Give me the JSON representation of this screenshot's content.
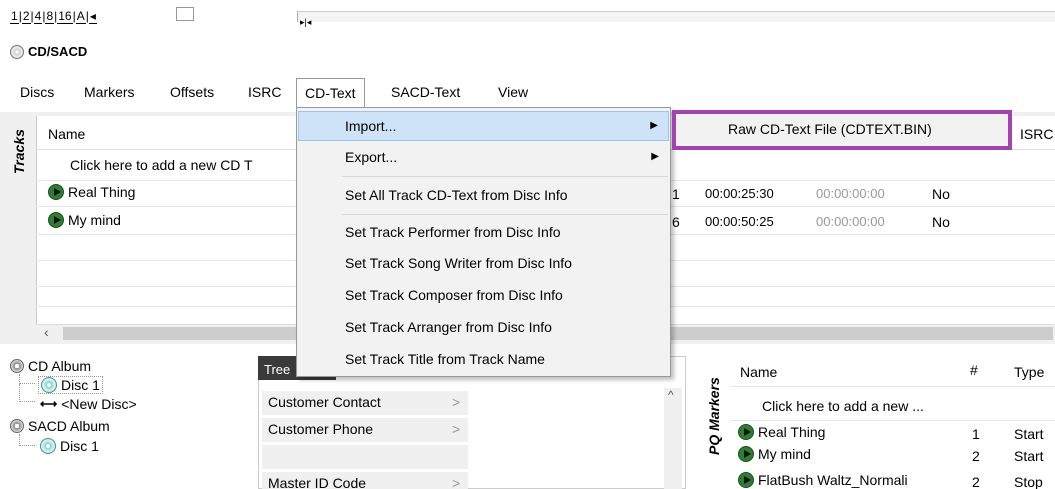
{
  "toolbar": {
    "zoom_buttons": [
      "1",
      "2",
      "4",
      "8",
      "16",
      "A",
      "◂"
    ],
    "hscroll_arrows": "▸|◂"
  },
  "section_title": "CD/SACD",
  "menu": [
    "Discs",
    "Markers",
    "Offsets",
    "ISRC",
    "CD-Text",
    "SACD-Text",
    "View"
  ],
  "tracks": {
    "side_label": "Tracks",
    "col_name": "Name",
    "col_isrc": "ISRC",
    "add_hint": "Click here to add a new CD T",
    "rows": [
      {
        "name": "Real Thing",
        "num_tail": "1",
        "duration": "00:00:25:30",
        "offset": "00:00:00:00",
        "flag": "No"
      },
      {
        "name": "My mind",
        "num_tail": "6",
        "duration": "00:00:50:25",
        "offset": "00:00:00:00",
        "flag": "No"
      }
    ]
  },
  "context_menu": {
    "items": [
      "Import...",
      "Export...",
      "Set All Track CD-Text from Disc Info",
      "Set Track Performer from Disc Info",
      "Set Track Song Writer from Disc Info",
      "Set Track Composer from Disc Info",
      "Set Track Arranger from Disc Info",
      "Set Track Title from Track Name"
    ],
    "submenu_item": "Raw CD-Text File (CDTEXT.BIN)",
    "highlight_color": "#cfe3f8",
    "submenu_border": "#a044b0"
  },
  "tree": {
    "cd_album": "CD Album",
    "disc1": "Disc 1",
    "new_disc": "<New Disc>",
    "sacd_album": "SACD Album",
    "sacd_disc1": "Disc 1"
  },
  "props": {
    "tab": "Tree",
    "rows": [
      "Customer Contact",
      "Customer Phone",
      "",
      "Master ID Code"
    ],
    "gt": ">"
  },
  "pq": {
    "side_label": "PQ Markers",
    "col_name": "Name",
    "col_num": "#",
    "col_type": "Type",
    "add_hint": "Click here to add a new ...",
    "rows": [
      {
        "name": "Real Thing",
        "num": "1",
        "type": "Start"
      },
      {
        "name": "My mind",
        "num": "2",
        "type": "Start"
      },
      {
        "name": "FlatBush Waltz_Normali",
        "num": "2",
        "type": "Stop"
      }
    ]
  }
}
